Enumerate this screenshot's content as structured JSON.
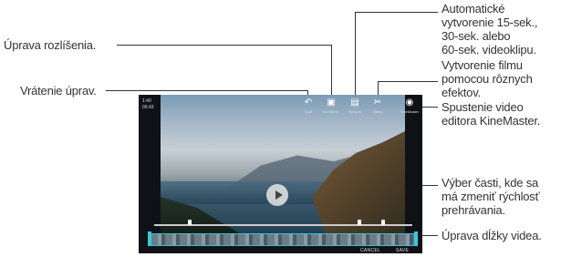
{
  "callouts": {
    "resolution": "Úprava rozlíšenia.",
    "undo": "Vrátenie úprav.",
    "auto_line1": "Automatické",
    "auto_line2": "vytvorenie 15-sek.,",
    "auto_line3": "30-sek. alebo",
    "auto_line4": "60-sek. videoklipu.",
    "effects_line1": "Vytvorenie filmu",
    "effects_line2": "pomocou rôznych",
    "effects_line3": "efektov.",
    "kinemaster_line1": "Spustenie video",
    "kinemaster_line2": "editora KineMaster.",
    "speed_line1": "Výber časti, kde sa",
    "speed_line2": "má zmeniť rýchlosť",
    "speed_line3": "prehrávania.",
    "length": "Úprava dĺžky videa."
  },
  "screen": {
    "left_info_line1": "1:40",
    "left_info_line2": "00:43",
    "toolbar": [
      {
        "icon": "undo-icon",
        "glyph": "↶",
        "label": "Späť"
      },
      {
        "icon": "resolution-icon",
        "glyph": "▣",
        "label": "Rozlíšenie"
      },
      {
        "icon": "auto-clip-icon",
        "glyph": "▤",
        "label": "Výťažok"
      },
      {
        "icon": "effects-icon",
        "glyph": "✂",
        "label": "Efekty"
      },
      {
        "icon": "kinemaster-icon",
        "glyph": "◉",
        "label": "KineMaster"
      }
    ],
    "cancel_label": "CANCEL",
    "save_label": "SAVE"
  },
  "colors": {
    "trim_accent": "#3bc6da",
    "callout_line": "#333333"
  }
}
